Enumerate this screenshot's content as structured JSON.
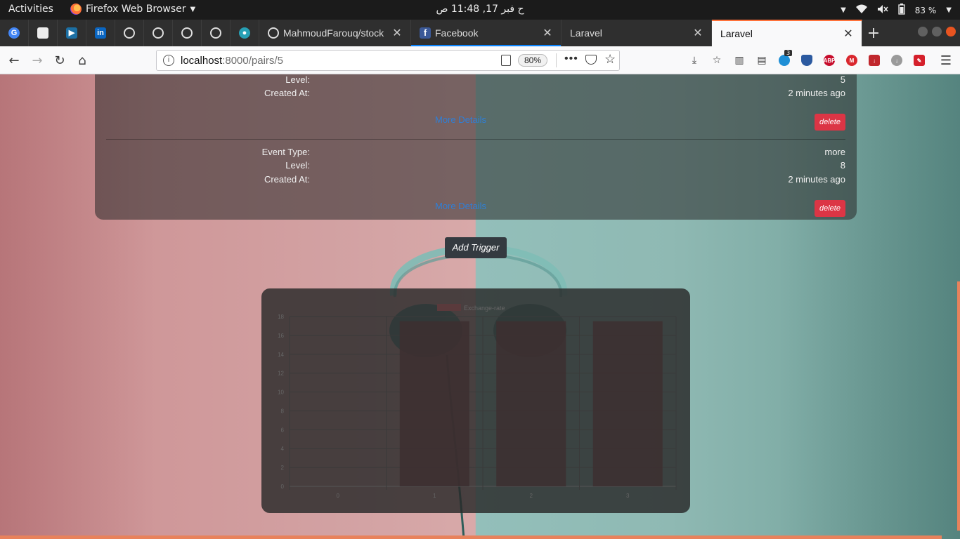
{
  "system": {
    "activities": "Activities",
    "app_name": "Firefox Web Browser",
    "clock": "ح فبر 17, 11:48 ص",
    "battery": "83 %"
  },
  "tabs": [
    {
      "title": "MahmoudFarouq/stock",
      "favicon": "github-icon",
      "active": false
    },
    {
      "title": "Facebook",
      "favicon": "facebook-icon",
      "active": false
    },
    {
      "title": "Laravel",
      "favicon": "none",
      "active": false
    },
    {
      "title": "Laravel",
      "favicon": "none",
      "active": true
    }
  ],
  "pinned_tabs": [
    "google-icon",
    "page-icon",
    "youtube-icon",
    "linkedin-icon",
    "github-icon",
    "github-icon",
    "github-icon",
    "github-icon",
    "mask-icon"
  ],
  "navbar": {
    "url_host": "localhost",
    "url_path": ":8000/pairs/5",
    "zoom": "80%",
    "extension_badge": "3",
    "abp_label": "ABP"
  },
  "events": [
    {
      "rows": [
        {
          "label": "Level:",
          "value": "5"
        },
        {
          "label": "Created At:",
          "value": "2 minutes ago"
        }
      ],
      "more_link": "More Details",
      "delete_label": "delete"
    },
    {
      "rows": [
        {
          "label": "Event Type:",
          "value": "more"
        },
        {
          "label": "Level:",
          "value": "8"
        },
        {
          "label": "Created At:",
          "value": "2 minutes ago"
        }
      ],
      "more_link": "More Details",
      "delete_label": "delete"
    }
  ],
  "add_trigger_label": "Add Trigger",
  "chart_data": {
    "type": "bar",
    "legend": "Exchange-rate",
    "categories": [
      "0",
      "1",
      "2",
      "3"
    ],
    "series": [
      {
        "name": "Exchange-rate",
        "values": [
          0,
          17.5,
          17.5,
          17.5
        ]
      }
    ],
    "ylim": [
      0,
      18
    ],
    "yticks": [
      0,
      2,
      4,
      6,
      8,
      10,
      12,
      14,
      16,
      18
    ],
    "grid": true
  },
  "colors": {
    "accent": "#ff7139",
    "delete": "#dc3545",
    "link": "#2f7fd6"
  }
}
